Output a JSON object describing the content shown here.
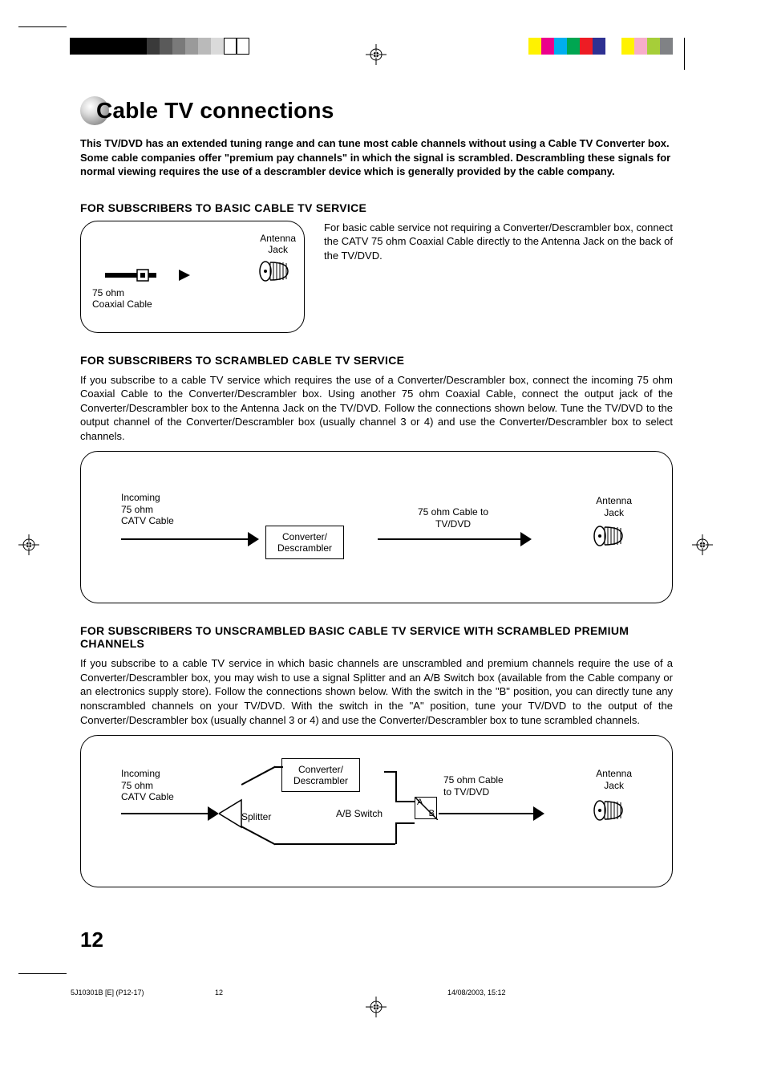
{
  "title": "Cable TV connections",
  "intro": "This TV/DVD has an extended tuning range and can tune most cable channels without using a Cable TV Converter box. Some cable companies offer \"premium pay channels\" in which the signal is scrambled. Descrambling these signals for normal viewing requires the use of a descrambler device which is generally provided by the cable company.",
  "section1": {
    "heading": "FOR SUBSCRIBERS TO BASIC CABLE TV SERVICE",
    "side_text": "For basic cable service not requiring a Converter/Descrambler box, connect the CATV 75 ohm Coaxial Cable directly to the Antenna Jack on the back of the TV/DVD.",
    "label_cable": "75 ohm\nCoaxial Cable",
    "label_jack": "Antenna\nJack"
  },
  "section2": {
    "heading": "FOR SUBSCRIBERS TO SCRAMBLED CABLE TV SERVICE",
    "body": "If you subscribe to a cable TV service which requires the use of a Converter/Descrambler box, connect the incoming 75 ohm Coaxial Cable to the Converter/Descrambler box. Using another 75 ohm Coaxial Cable, connect the output jack of the Converter/Descrambler box to the Antenna Jack on the TV/DVD. Follow the connections shown below. Tune the TV/DVD to the output channel of the Converter/Descrambler box (usually channel 3 or 4) and use the Converter/Descrambler box to select channels.",
    "label_incoming": "Incoming\n75 ohm\nCATV Cable",
    "label_converter": "Converter/\nDescrambler",
    "label_cable_tv": "75 ohm Cable to\nTV/DVD",
    "label_jack": "Antenna\nJack"
  },
  "section3": {
    "heading": "FOR SUBSCRIBERS TO UNSCRAMBLED BASIC CABLE TV SERVICE WITH SCRAMBLED PREMIUM CHANNELS",
    "body": "If you subscribe to a cable TV service in which basic channels are unscrambled and premium channels require the use of a Converter/Descrambler box, you may wish to use a signal Splitter and an A/B Switch box (available from the Cable company or an electronics supply store). Follow the connections shown below. With the switch in the \"B\" position, you can directly tune any nonscrambled channels on your TV/DVD. With the switch in the \"A\" position, tune your TV/DVD to the output of the Converter/Descrambler box (usually channel 3 or 4) and use the Converter/Descrambler box to tune scrambled channels.",
    "label_incoming": "Incoming\n75 ohm\nCATV Cable",
    "label_splitter": "Splitter",
    "label_converter": "Converter/\nDescrambler",
    "label_ab": "A/B Switch",
    "label_a": "A",
    "label_b": "B",
    "label_cable_tv": "75 ohm Cable\nto TV/DVD",
    "label_jack": "Antenna\nJack"
  },
  "page_number": "12",
  "footer": {
    "doc_id": "5J10301B [E] (P12-17)",
    "page": "12",
    "datetime": "14/08/2003, 15:12"
  },
  "colorbar_left": [
    "#000",
    "#000",
    "#000",
    "#1a1a1a",
    "#333",
    "#4d4d4d",
    "#666",
    "#808080",
    "#999",
    "#b3b3b3",
    "#ccc",
    "#e6e6e6",
    "#fff",
    "#fff"
  ],
  "colorbar_right": [
    "#00aeef",
    "#ec008c",
    "#00a651",
    "#2e3192",
    "#ed1c24",
    "#fff200",
    "#f7adc9",
    "#a6ce39",
    "#808285"
  ]
}
